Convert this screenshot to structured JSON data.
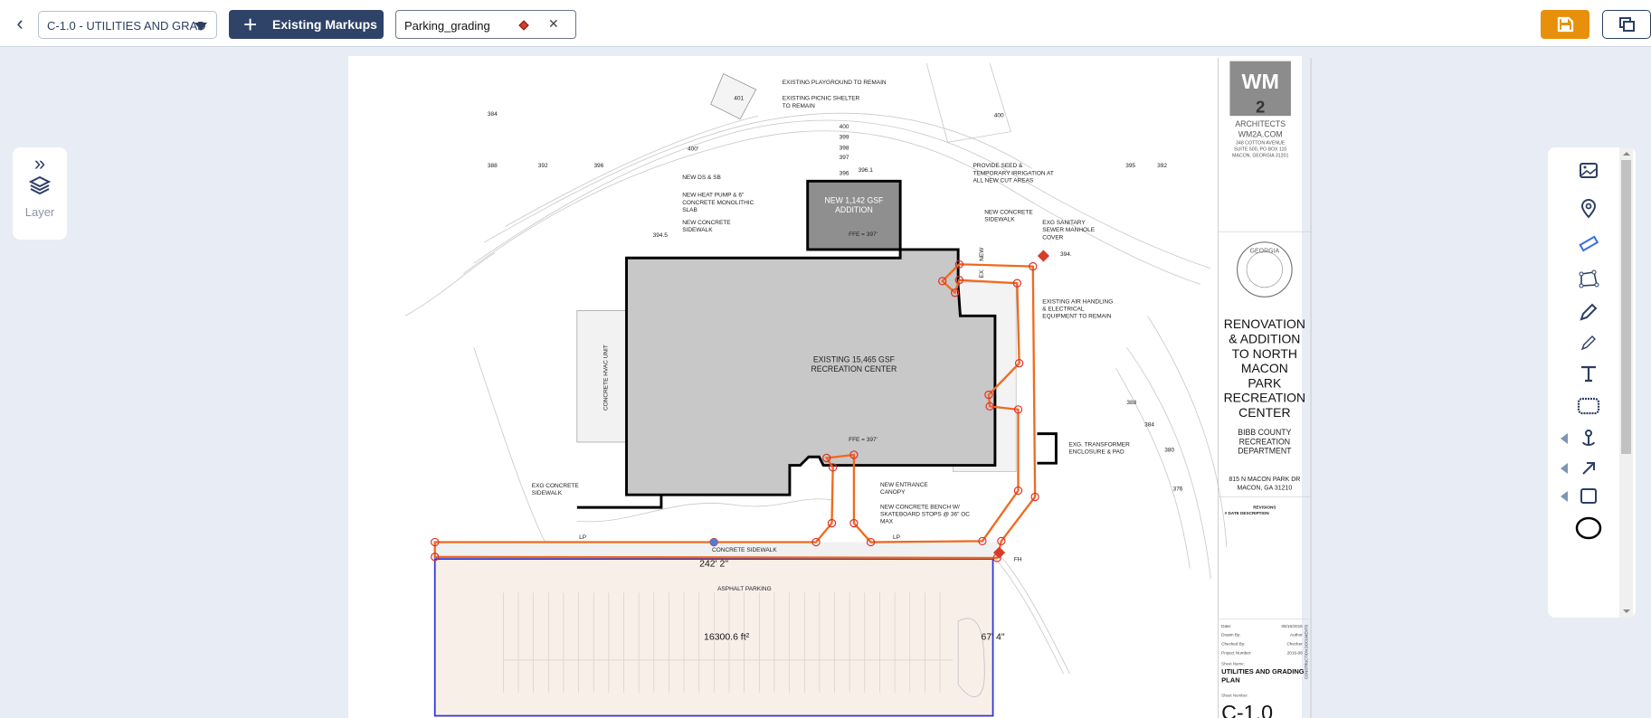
{
  "topbar": {
    "back_icon": "chevron-left-icon",
    "sheet_select": "C-1.0 - UTILITIES AND GRAD",
    "existing_markups": "Existing Markups",
    "markup_tab": "Parking_grading",
    "markup_color": "#d93b2b",
    "save_color": "#e8900b"
  },
  "layer_panel": {
    "label": "Layer"
  },
  "tools": [
    "image-icon",
    "location-pin-icon",
    "ruler-icon",
    "polygon-icon",
    "pencil-icon",
    "highlighter-icon",
    "text-icon",
    "cloud-icon",
    "anchor-icon",
    "arrow-icon",
    "rectangle-icon",
    "circle-icon"
  ],
  "drawing": {
    "labels": [
      "EXISTING PLAYGROUND TO REMAIN",
      "EXISTING PICNIC SHELTER",
      "TO REMAIN",
      "401",
      "400",
      "399",
      "398",
      "397",
      "396",
      "396.1",
      "400'",
      "384",
      "388",
      "392",
      "396",
      "400",
      "395",
      "392",
      "NEW DS & SB",
      "NEW HEAT PUMP & 6\"",
      "CONCRETE MONOLITHIC",
      "SLAB",
      "NEW CONCRETE",
      "SIDEWALK",
      "PROVIDE SEED &",
      "TEMPORARY IRRIGATION AT",
      "ALL NEW CUT AREAS",
      "NEW CONCRETE",
      "SIDEWALK",
      "EXG SANITARY",
      "SEWER MANHOLE",
      "COVER",
      "394.5",
      "NEW 1,142 GSF",
      "ADDITION",
      "FFE = 397'",
      "EXISTING AIR HANDLING",
      "& ELECTRICAL",
      "EQUIPMENT TO REMAIN",
      "EXISTING 15,465 GSF",
      "RECREATION CENTER",
      "CONCRETE HVAC UNIT",
      "FFE = 397'",
      "EXG. TRANSFORMER",
      "ENCLOSURE & PAD",
      "EXG CONCRETE",
      "SIDEWALK",
      "NEW ENTRANCE",
      "CANOPY",
      "NEW CONCRETE BENCH W/",
      "SKATEBOARD STOPS @ 36\" OC",
      "MAX",
      "LP",
      "LP",
      "CONCRETE SIDEWALK",
      "FH",
      "ASPHALT PARKING",
      "388",
      "384",
      "380",
      "376",
      "394.",
      "EX",
      "NEW"
    ],
    "measure": {
      "width": "242' 2\"",
      "area": "16300.6 ft²",
      "height": "67' 4\""
    },
    "markup_stroke": "#ef6a1e",
    "measure_stroke": "#2a35d8"
  },
  "title_block": {
    "firm": [
      "WM",
      "2",
      "ARCHITECTS",
      "WM2A.COM",
      "348 COTTON AVENUE",
      "SUITE 500, PO BOX 110",
      "MACON, GEORGIA 31201"
    ],
    "seal": "GEORGIA",
    "project": [
      "RENOVATION",
      "& ADDITION",
      "TO NORTH",
      "MACON",
      "PARK",
      "RECREATION",
      "CENTER"
    ],
    "client": [
      "BIBB COUNTY",
      "RECREATION",
      "DEPARTMENT"
    ],
    "address": [
      "815 N MACON PARK DR",
      "MACON, GA 31210"
    ],
    "revisions": "REVISIONS",
    "rev_cols": "#   DATE   DESCRIPTION",
    "fields": [
      {
        "label": "Date:",
        "value": "05/16/2016"
      },
      {
        "label": "Drawn By:",
        "value": "Author"
      },
      {
        "label": "Checked By:",
        "value": "Checker"
      },
      {
        "label": "Project Number:",
        "value": "2016-08"
      }
    ],
    "sheet_name_label": "Sheet Name:",
    "sheet_name": [
      "UTILITIES AND GRADING",
      "PLAN"
    ],
    "sheet_number_label": "Sheet Number:",
    "sheet_number": "C-1.0",
    "side_stamp": "CONSTRUCTION DOCUMENTS"
  }
}
